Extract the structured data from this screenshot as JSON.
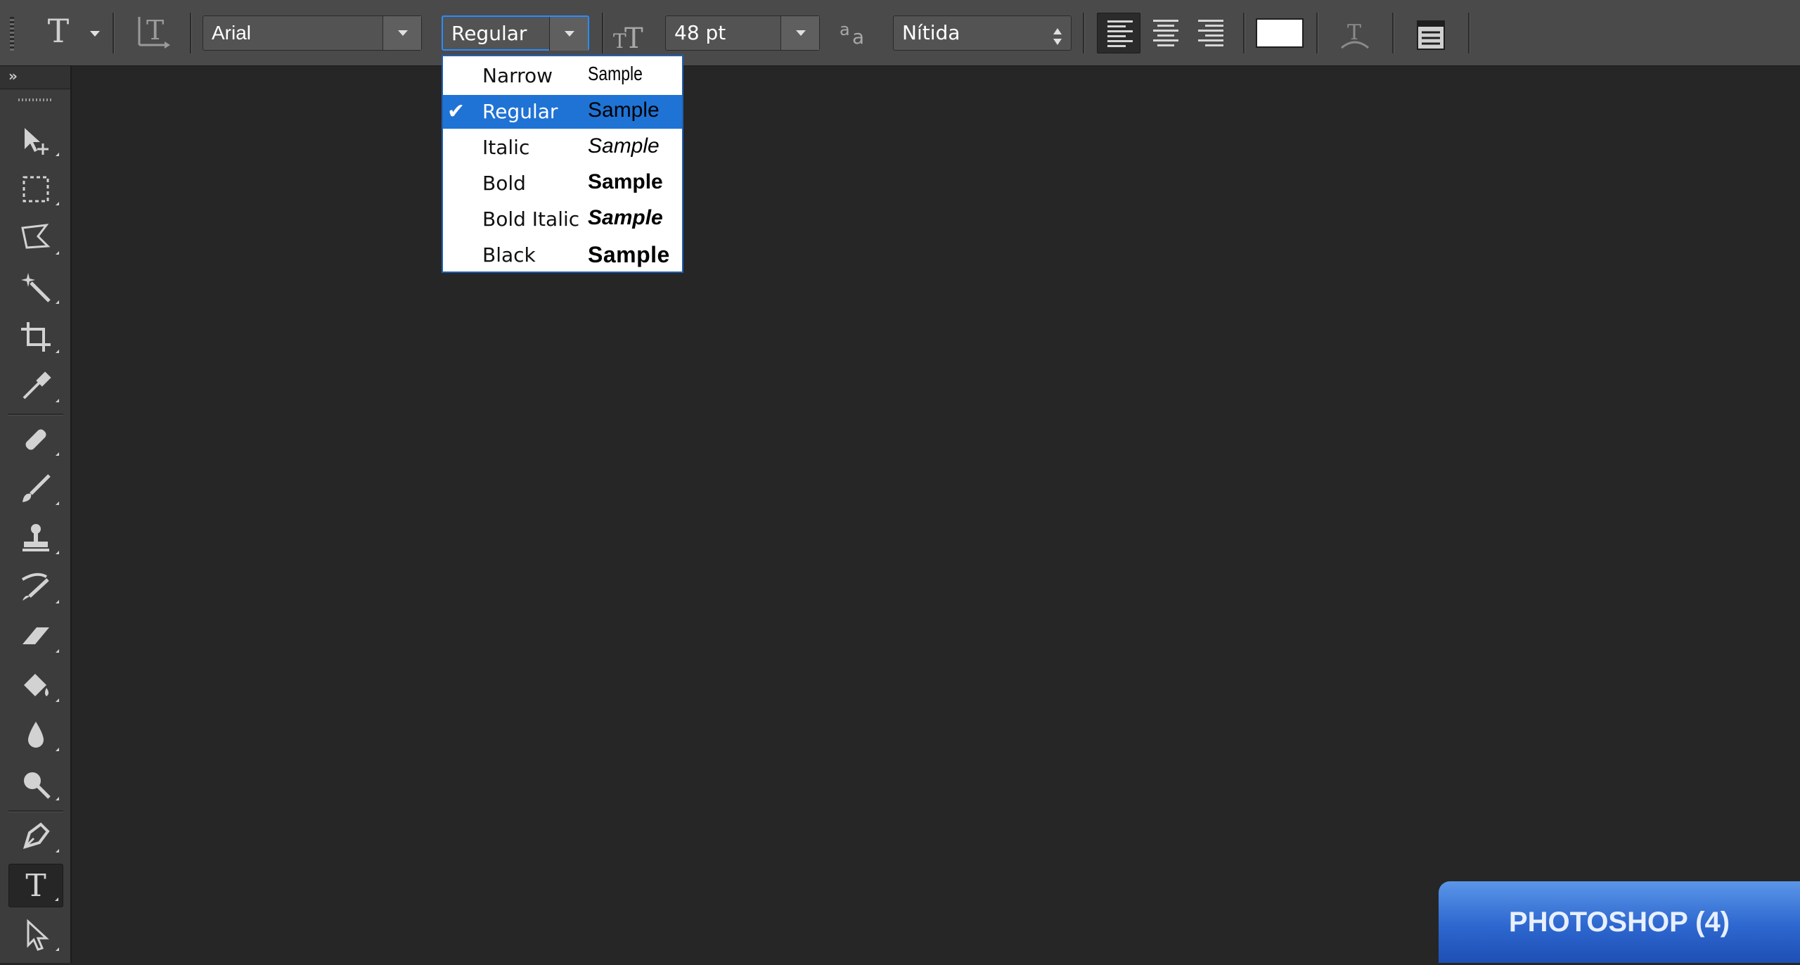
{
  "options_bar": {
    "tool_icon": "type-tool-icon",
    "orientation_icon": "text-orientation-icon",
    "font_family": "Arial",
    "font_style": "Regular",
    "size_icon": "font-size-icon",
    "font_size": "48 pt",
    "antialias_icon": "antialias-icon",
    "antialias": "Nítida",
    "align": [
      "left",
      "center",
      "right"
    ],
    "align_active": "left",
    "text_color": "#ffffff",
    "warp_icon": "warp-text-icon",
    "panels_icon": "character-panel-icon"
  },
  "style_menu": {
    "items": [
      {
        "label": "Narrow",
        "sample": "Sample",
        "selected": false
      },
      {
        "label": "Regular",
        "sample": "Sample",
        "selected": true
      },
      {
        "label": "Italic",
        "sample": "Sample",
        "selected": false
      },
      {
        "label": "Bold",
        "sample": "Sample",
        "selected": false
      },
      {
        "label": "Bold Italic",
        "sample": "Sample",
        "selected": false
      },
      {
        "label": "Black",
        "sample": "Sample",
        "selected": false
      }
    ]
  },
  "tools": [
    {
      "name": "move-tool-icon"
    },
    {
      "name": "marquee-tool-icon"
    },
    {
      "name": "lasso-tool-icon"
    },
    {
      "name": "magic-wand-tool-icon"
    },
    {
      "name": "crop-tool-icon"
    },
    {
      "name": "eyedropper-tool-icon"
    },
    {
      "name": "healing-brush-tool-icon"
    },
    {
      "name": "brush-tool-icon"
    },
    {
      "name": "clone-stamp-tool-icon"
    },
    {
      "name": "history-brush-tool-icon"
    },
    {
      "name": "eraser-tool-icon"
    },
    {
      "name": "paint-bucket-tool-icon"
    },
    {
      "name": "blur-tool-icon"
    },
    {
      "name": "dodge-tool-icon"
    },
    {
      "name": "pen-tool-icon"
    },
    {
      "name": "type-tool-icon",
      "active": true
    },
    {
      "name": "path-selection-tool-icon"
    }
  ],
  "badge": {
    "text": "PHOTOSHOP (4)"
  },
  "colors": {
    "accent": "#1f73d4",
    "badge": "#2d67cf",
    "canvas": "#262626"
  }
}
